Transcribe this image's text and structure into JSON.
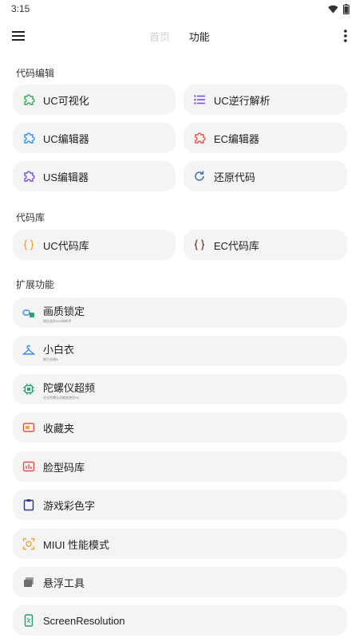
{
  "status": {
    "time": "3:15"
  },
  "header": {
    "tabs": [
      "首页",
      "功能"
    ]
  },
  "sections": {
    "code_edit": "代码编辑",
    "code_lib": "代码库",
    "ext": "扩展功能"
  },
  "code_edit": {
    "uc_visualize": "UC可视化",
    "uc_reverse": "UC逆行解析",
    "uc_editor": "UC编辑器",
    "ec_editor": "EC编辑器",
    "us_editor": "US编辑器",
    "restore": "还原代码"
  },
  "code_lib": {
    "uc_lib": "UC代码库",
    "ec_lib": "EC代码库"
  },
  "ext": {
    "quality_lock": "画质锁定",
    "quality_lock_sub": "锁定画质46H刷新率",
    "white_outfit": "小白衣",
    "white_outfit_sub": "刷白衣服B",
    "gyro": "陀螺仪超频",
    "gyro_sub": "优化陀螺仪灵敏度使用HZ",
    "favorites": "收藏夹",
    "face_lib": "脸型码库",
    "color_text": "游戏彩色字",
    "miui_perf": "MIUI 性能模式",
    "float_tool": "悬浮工具",
    "screen_res": "ScreenResolution"
  },
  "colors": {
    "green": "#39a85a",
    "purple": "#7a4fd6",
    "blue": "#3a8ee6",
    "red": "#e05252",
    "orange": "#f2a33a",
    "brown": "#6b4a3a",
    "navy": "#2f3e8c",
    "teal": "#2ea06f"
  }
}
